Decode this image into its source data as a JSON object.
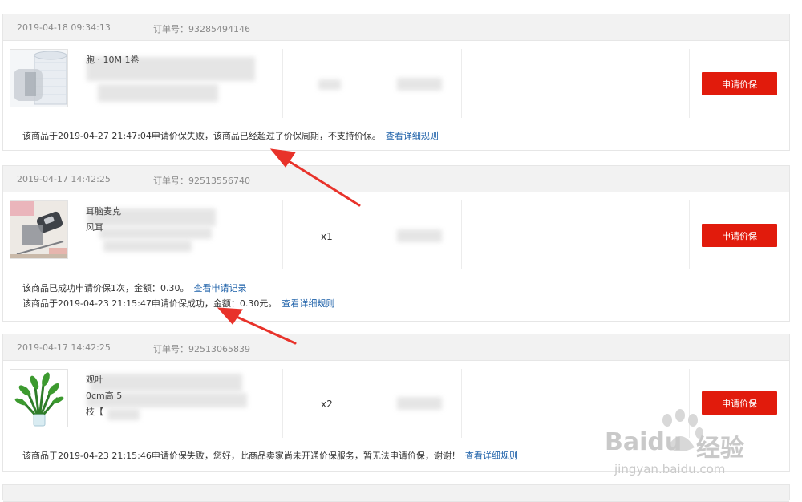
{
  "orders": [
    {
      "date": "2019-04-18 09:34:13",
      "order_label": "订单号：93285494146",
      "product_line_1": "",
      "product_line_2": "",
      "product_line_3": "胞                 · 10M 1卷",
      "qty": "",
      "button": "申请价保",
      "msg1_text": "该商品于2019-04-27 21:47:04申请价保失败，该商品已经超过了价保周期，不支持价保。",
      "msg1_link": "查看详细规则"
    },
    {
      "date": "2019-04-17 14:42:25",
      "order_label": "订单号：92513556740",
      "product_line_1": "",
      "product_line_2": "                             耳脑麦克",
      "product_line_3": "风耳",
      "qty": "x1",
      "button": "申请价保",
      "msg1_text": "该商品已成功申请价保1次，金额：0.30。",
      "msg1_link": "查看申请记录",
      "msg2_text": "该商品于2019-04-23 21:15:47申请价保成功，金额：0.30元。",
      "msg2_link": "查看详细规则"
    },
    {
      "date": "2019-04-17 14:42:25",
      "order_label": "订单号：92513065839",
      "product_line_1": "                              观叶",
      "product_line_2": "                              0cm高 5",
      "product_line_3": "枝【",
      "qty": "x2",
      "button": "申请价保",
      "msg1_text": "该商品于2019-04-23 21:15:46申请价保失败，您好，此商品卖家尚未开通价保服务，暂无法申请价保，谢谢！",
      "msg1_link": "查看详细规则"
    }
  ],
  "watermark": {
    "brand_latin": "Bai",
    "brand_latin_2": "du",
    "brand_cn": "经验",
    "url": "jingyan.baidu.com"
  },
  "colors": {
    "accent_button": "#e11b0c",
    "link": "#1b5fa8",
    "arrow": "#e8322a"
  }
}
